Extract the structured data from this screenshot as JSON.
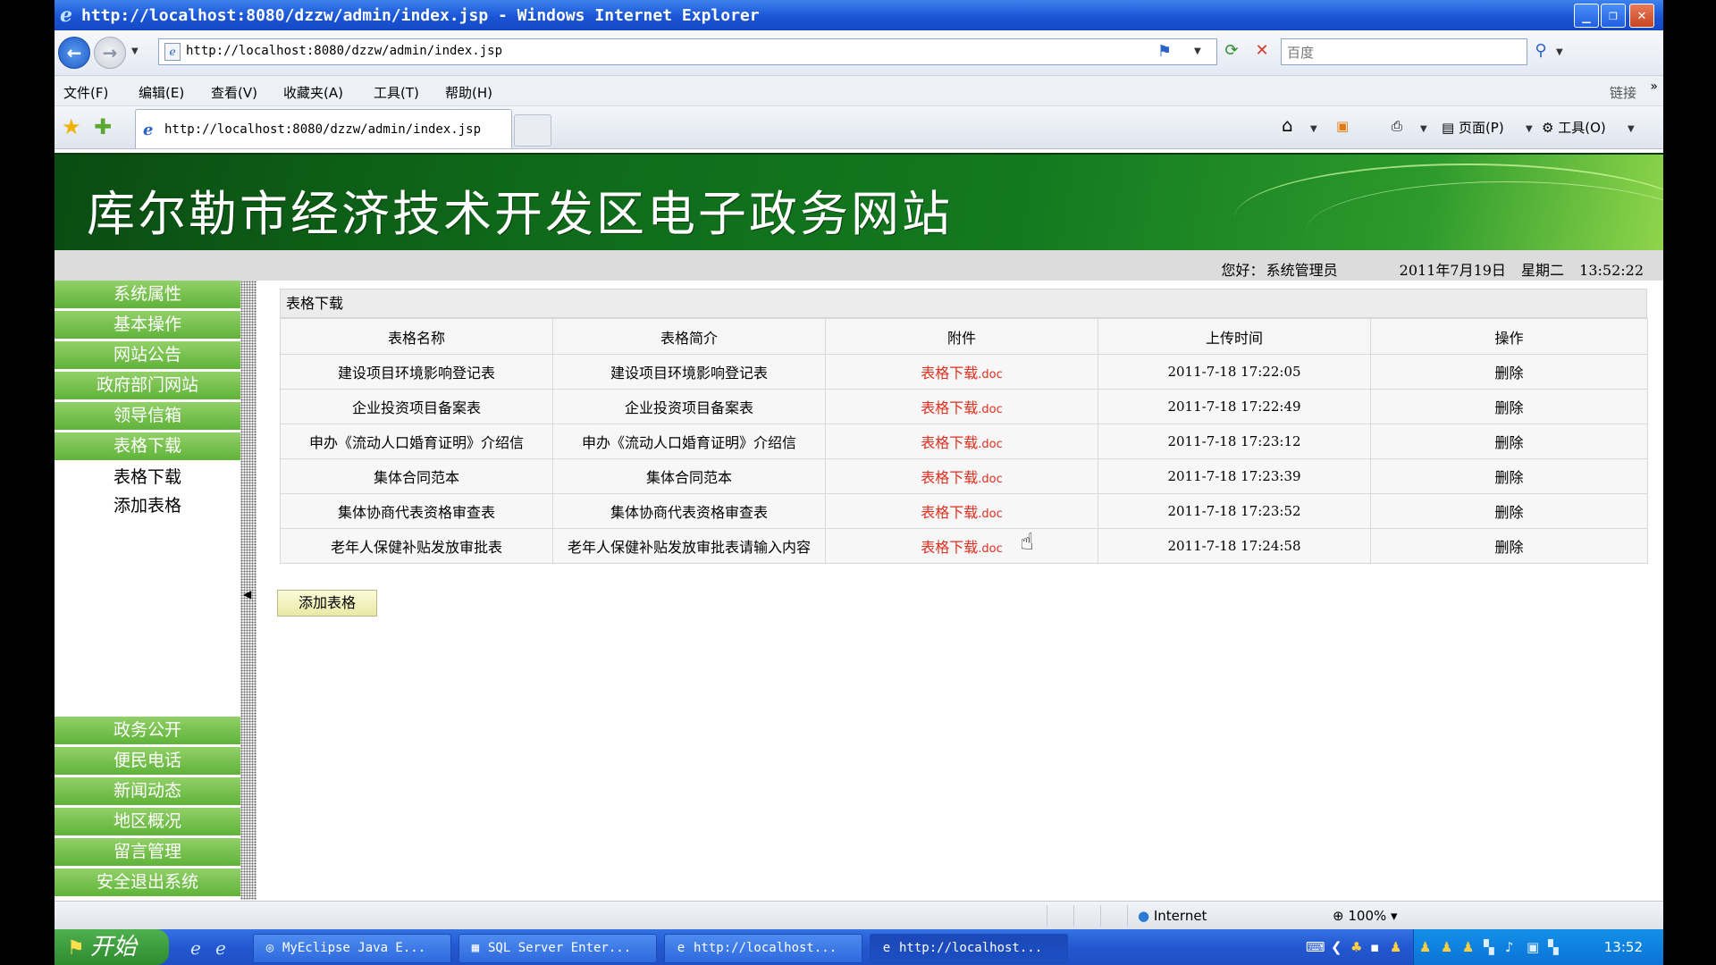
{
  "browser": {
    "window_title": "http://localhost:8080/dzzw/admin/index.jsp - Windows Internet Explorer",
    "address": "http://localhost:8080/dzzw/admin/index.jsp",
    "search_placeholder": "百度",
    "menu": [
      "文件(F)",
      "编辑(E)",
      "查看(V)",
      "收藏夹(A)",
      "工具(T)",
      "帮助(H)"
    ],
    "links_label": "链接",
    "tab_title": "http://localhost:8080/dzzw/admin/index.jsp",
    "page_menu": "页面(P)",
    "tools_menu": "工具(O)",
    "status_zone": "Internet",
    "zoom": "100%"
  },
  "site": {
    "banner_title": "库尔勒市经济技术开发区电子政务网站",
    "greeting": "您好：",
    "user": "系统管理员",
    "date": "2011年7月19日",
    "weekday": "星期二",
    "time": "13:52:22"
  },
  "sidebar": {
    "top_items": [
      "系统属性",
      "基本操作",
      "网站公告",
      "政府部门网站",
      "领导信箱",
      "表格下载"
    ],
    "sub_items": [
      "表格下载",
      "添加表格"
    ],
    "bottom_items": [
      "政务公开",
      "便民电话",
      "新闻动态",
      "地区概况",
      "留言管理",
      "安全退出系统"
    ]
  },
  "main": {
    "panel_title": "表格下载",
    "columns": [
      "表格名称",
      "表格简介",
      "附件",
      "上传时间",
      "操作"
    ],
    "rows": [
      {
        "name": "建设项目环境影响登记表",
        "desc": "建设项目环境影响登记表",
        "attach": "表格下载",
        "ext": ".doc",
        "time": "2011-7-18 17:22:05",
        "op": "删除"
      },
      {
        "name": "企业投资项目备案表",
        "desc": "企业投资项目备案表",
        "attach": "表格下载",
        "ext": ".doc",
        "time": "2011-7-18 17:22:49",
        "op": "删除"
      },
      {
        "name": "申办《流动人口婚育证明》介绍信",
        "desc": "申办《流动人口婚育证明》介绍信",
        "attach": "表格下载",
        "ext": ".doc",
        "time": "2011-7-18 17:23:12",
        "op": "删除"
      },
      {
        "name": "集体合同范本",
        "desc": "集体合同范本",
        "attach": "表格下载",
        "ext": ".doc",
        "time": "2011-7-18 17:23:39",
        "op": "删除"
      },
      {
        "name": "集体协商代表资格审查表",
        "desc": "集体协商代表资格审查表",
        "attach": "表格下载",
        "ext": ".doc",
        "time": "2011-7-18 17:23:52",
        "op": "删除"
      },
      {
        "name": "老年人保健补贴发放审批表",
        "desc": "老年人保健补贴发放审批表请输入内容",
        "attach": "表格下载",
        "ext": ".doc",
        "time": "2011-7-18 17:24:58",
        "op": "删除"
      }
    ],
    "add_button": "添加表格"
  },
  "taskbar": {
    "start": "开始",
    "tasks": [
      "MyEclipse Java E...",
      "SQL Server Enter...",
      "http://localhost...",
      "http://localhost..."
    ],
    "clock": "13:52"
  }
}
